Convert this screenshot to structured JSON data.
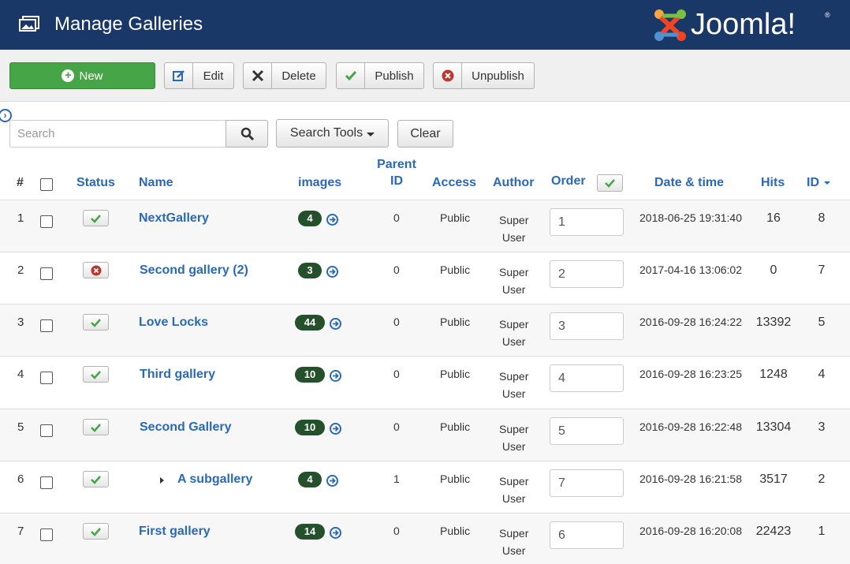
{
  "header": {
    "title": "Manage Galleries",
    "logo_text": "Joomla!",
    "logo_reg": "®"
  },
  "toolbar": {
    "new_label": "New",
    "edit_label": "Edit",
    "delete_label": "Delete",
    "publish_label": "Publish",
    "unpublish_label": "Unpublish"
  },
  "search": {
    "placeholder": "Search",
    "value": "",
    "tools_label": "Search Tools",
    "clear_label": "Clear"
  },
  "table": {
    "columns": {
      "num": "#",
      "status": "Status",
      "name": "Name",
      "images": "images",
      "parent_line1": "Parent",
      "parent_line2": "ID",
      "access": "Access",
      "author": "Author",
      "order": "Order",
      "date": "Date & time",
      "hits": "Hits",
      "id": "ID"
    },
    "rows": [
      {
        "num": "1",
        "status": "published",
        "name": "NextGallery",
        "images": "4",
        "parent": "0",
        "access": "Public",
        "author1": "Super",
        "author2": "User",
        "order": "1",
        "date": "2018-06-25 19:31:40",
        "hits": "16",
        "id": "8"
      },
      {
        "num": "2",
        "status": "unpublished",
        "name": "Second gallery (2)",
        "images": "3",
        "parent": "0",
        "access": "Public",
        "author1": "Super",
        "author2": "User",
        "order": "2",
        "date": "2017-04-16 13:06:02",
        "hits": "0",
        "id": "7"
      },
      {
        "num": "3",
        "status": "published",
        "name": "Love Locks",
        "images": "44",
        "parent": "0",
        "access": "Public",
        "author1": "Super",
        "author2": "User",
        "order": "3",
        "date": "2016-09-28 16:24:22",
        "hits": "13392",
        "id": "5"
      },
      {
        "num": "4",
        "status": "published",
        "name": "Third gallery",
        "images": "10",
        "parent": "0",
        "access": "Public",
        "author1": "Super",
        "author2": "User",
        "order": "4",
        "date": "2016-09-28 16:23:25",
        "hits": "1248",
        "id": "4"
      },
      {
        "num": "5",
        "status": "published",
        "name": "Second Gallery",
        "images": "10",
        "parent": "0",
        "access": "Public",
        "author1": "Super",
        "author2": "User",
        "order": "5",
        "date": "2016-09-28 16:22:48",
        "hits": "13304",
        "id": "3"
      },
      {
        "num": "6",
        "status": "published",
        "name": "A subgallery",
        "images": "4",
        "parent": "1",
        "access": "Public",
        "author1": "Super",
        "author2": "User",
        "order": "7",
        "date": "2016-09-28 16:21:58",
        "hits": "3517",
        "id": "2"
      },
      {
        "num": "7",
        "status": "published",
        "name": "First gallery",
        "images": "14",
        "parent": "0",
        "access": "Public",
        "author1": "Super",
        "author2": "User",
        "order": "6",
        "date": "2016-09-28 16:20:08",
        "hits": "22423",
        "id": "1"
      }
    ]
  },
  "colors": {
    "header_bg": "#1a3867",
    "link": "#2a69b8",
    "new_button": "#46a546",
    "badge": "#24502c",
    "publish_check": "#46a546",
    "unpublish_x": "#bd362f"
  }
}
